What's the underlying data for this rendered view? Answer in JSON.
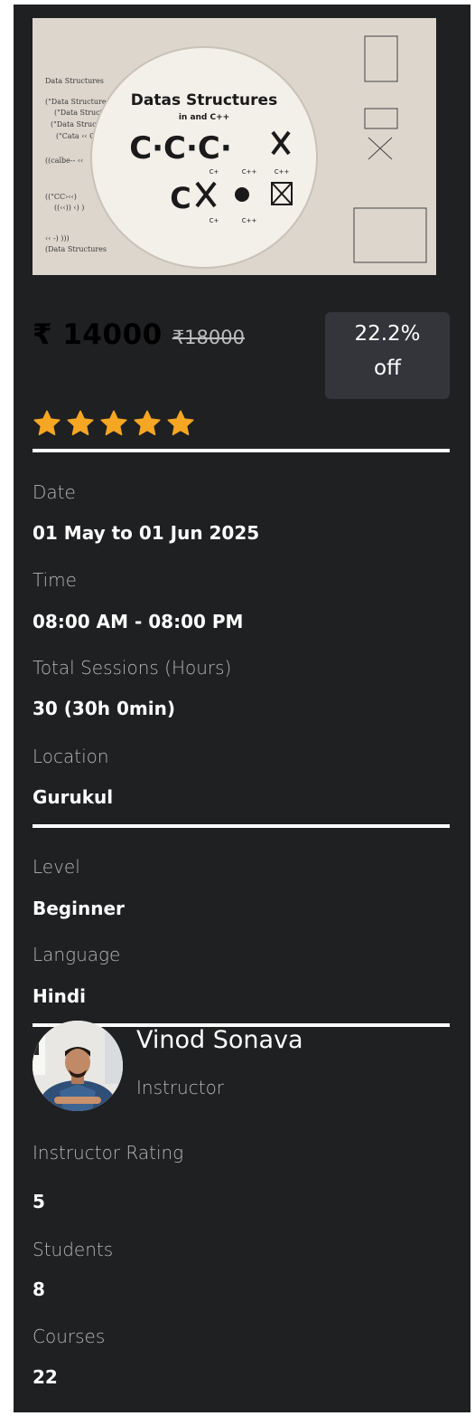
{
  "course": {
    "image_alt": "Datas Structures in and C++",
    "image_title": "Datas Structures",
    "image_subtitle": "in and C++"
  },
  "pricing": {
    "price": "₹ 14000",
    "original_price": "₹18000",
    "discount": "22.2%",
    "discount_suffix": "off"
  },
  "rating": {
    "stars": 5,
    "star_color": "#f5a623"
  },
  "details": {
    "date_label": "Date",
    "date_value": "01 May to 01 Jun 2025",
    "time_label": "Time",
    "time_value": "08:00 AM - 08:00 PM",
    "sessions_label": "Total Sessions (Hours)",
    "sessions_value": "30 (30h 0min)",
    "location_label": "Location",
    "location_value": "Gurukul",
    "level_label": "Level",
    "level_value": "Beginner",
    "language_label": "Language",
    "language_value": "Hindi"
  },
  "instructor": {
    "name": "Vinod Sonava",
    "role": "Instructor",
    "rating_label": "Instructor Rating",
    "rating_value": "5",
    "students_label": "Students",
    "students_value": "8",
    "courses_label": "Courses",
    "courses_value": "22"
  },
  "colors": {
    "card_bg": "#1f2022",
    "badge_bg": "#33353a",
    "label": "#b5b5b5",
    "value": "#ffffff",
    "star": "#f5a623"
  }
}
